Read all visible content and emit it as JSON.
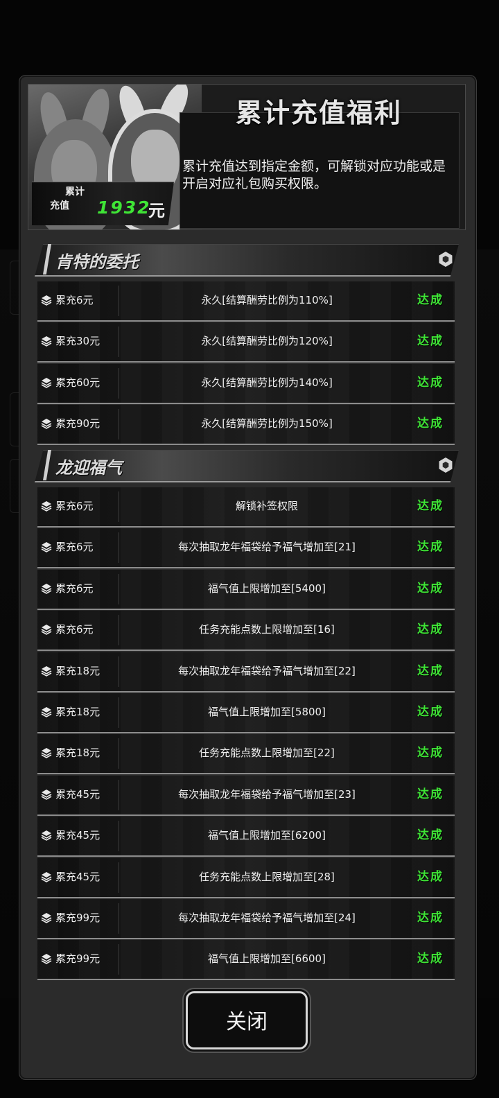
{
  "header": {
    "title": "累计充值福利",
    "description": "累计充值达到指定金额，可解锁对应功能或是开启对应礼包购买权限。",
    "total_label_line1": "累计",
    "total_label_line2": "充值",
    "total_value": "1932",
    "total_unit": "元"
  },
  "sections": [
    {
      "title": "肯特的委托",
      "rows": [
        {
          "condition": "累充6元",
          "reward": "永久[结算酬劳比例为110%]",
          "status": "达成"
        },
        {
          "condition": "累充30元",
          "reward": "永久[结算酬劳比例为120%]",
          "status": "达成"
        },
        {
          "condition": "累充60元",
          "reward": "永久[结算酬劳比例为140%]",
          "status": "达成"
        },
        {
          "condition": "累充90元",
          "reward": "永久[结算酬劳比例为150%]",
          "status": "达成"
        }
      ]
    },
    {
      "title": "龙迎福气",
      "rows": [
        {
          "condition": "累充6元",
          "reward": "解锁补签权限",
          "status": "达成"
        },
        {
          "condition": "累充6元",
          "reward": "每次抽取龙年福袋给予福气增加至[21]",
          "status": "达成"
        },
        {
          "condition": "累充6元",
          "reward": "福气值上限增加至[5400]",
          "status": "达成"
        },
        {
          "condition": "累充6元",
          "reward": "任务充能点数上限增加至[16]",
          "status": "达成"
        },
        {
          "condition": "累充18元",
          "reward": "每次抽取龙年福袋给予福气增加至[22]",
          "status": "达成"
        },
        {
          "condition": "累充18元",
          "reward": "福气值上限增加至[5800]",
          "status": "达成"
        },
        {
          "condition": "累充18元",
          "reward": "任务充能点数上限增加至[22]",
          "status": "达成"
        },
        {
          "condition": "累充45元",
          "reward": "每次抽取龙年福袋给予福气增加至[23]",
          "status": "达成"
        },
        {
          "condition": "累充45元",
          "reward": "福气值上限增加至[6200]",
          "status": "达成"
        },
        {
          "condition": "累充45元",
          "reward": "任务充能点数上限增加至[28]",
          "status": "达成"
        },
        {
          "condition": "累充99元",
          "reward": "每次抽取龙年福袋给予福气增加至[24]",
          "status": "达成"
        },
        {
          "condition": "累充99元",
          "reward": "福气值上限增加至[6600]",
          "status": "达成"
        }
      ]
    }
  ],
  "close_label": "关闭",
  "colors": {
    "accent_green": "#3fe536"
  },
  "icons": {
    "row_icon": "stack-icon",
    "section_icon": "hexagon-icon"
  }
}
